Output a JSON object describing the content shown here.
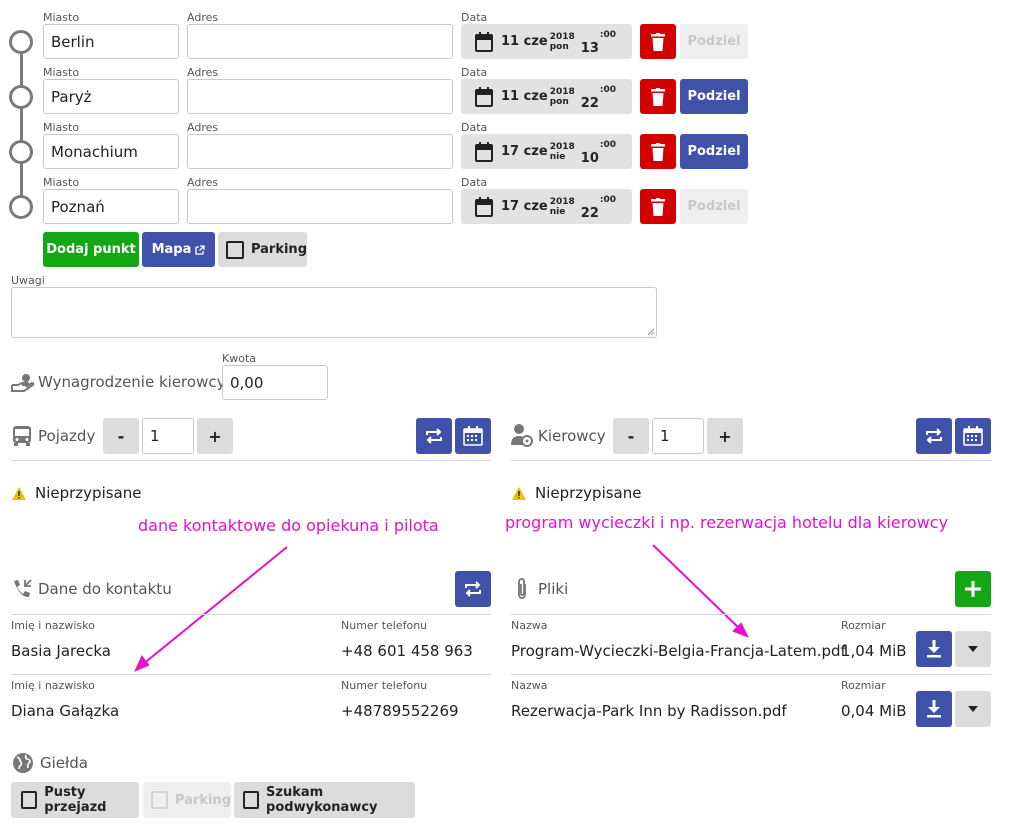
{
  "waypoints": {
    "label_city": "Miasto",
    "label_address": "Adres",
    "label_date": "Data",
    "split_label": "Podziel",
    "rows": [
      {
        "city": "Berlin",
        "address": "",
        "day": "11 cze",
        "year": "2018",
        "weekday": "pon",
        "hour": "13",
        "minute": ":00",
        "split_enabled": false
      },
      {
        "city": "Paryż",
        "address": "",
        "day": "11 cze",
        "year": "2018",
        "weekday": "pon",
        "hour": "22",
        "minute": ":00",
        "split_enabled": true
      },
      {
        "city": "Monachium",
        "address": "",
        "day": "17 cze",
        "year": "2018",
        "weekday": "nie",
        "hour": "10",
        "minute": ":00",
        "split_enabled": true
      },
      {
        "city": "Poznań",
        "address": "",
        "day": "17 cze",
        "year": "2018",
        "weekday": "nie",
        "hour": "22",
        "minute": ":00",
        "split_enabled": false
      }
    ]
  },
  "actions": {
    "add_point": "Dodaj punkt",
    "map": "Mapa",
    "parking": "Parking"
  },
  "notes": {
    "label": "Uwagi",
    "value": ""
  },
  "driver_pay": {
    "label": "Wynagrodzenie kierowcy",
    "amount_label": "Kwota",
    "amount": "0,00"
  },
  "vehicles": {
    "label": "Pojazdy",
    "count": "1",
    "minus": "-",
    "plus": "+",
    "status": "Nieprzypisane"
  },
  "drivers": {
    "label": "Kierowcy",
    "count": "1",
    "minus": "-",
    "plus": "+",
    "status": "Nieprzypisane"
  },
  "annotations": {
    "left": "dane kontaktowe do opiekuna i pilota",
    "right": "program wycieczki i np. rezerwacja hotelu dla kierowcy"
  },
  "contacts": {
    "title": "Dane do kontaktu",
    "col_name": "Imię i nazwisko",
    "col_phone": "Numer telefonu",
    "rows": [
      {
        "name": "Basia Jarecka",
        "phone": "+48 601 458 963"
      },
      {
        "name": "Diana Gałązka",
        "phone": "+48789552269"
      }
    ]
  },
  "files": {
    "title": "Pliki",
    "col_name": "Nazwa",
    "col_size": "Rozmiar",
    "rows": [
      {
        "name": "Program-Wycieczki-Belgia-Francja-Latem.pdf",
        "size": "1,04 MiB"
      },
      {
        "name": "Rezerwacja-Park Inn by Radisson.pdf",
        "size": "0,04 MiB"
      }
    ]
  },
  "exchange": {
    "title": "Giełda",
    "empty_run": "Pusty przejazd",
    "parking": "Parking",
    "subcontractor": "Szukam podwykonawcy"
  },
  "colors": {
    "primary": "#3f51a8",
    "danger": "#d40000",
    "success": "#13a813",
    "annotation": "#e412c8"
  }
}
